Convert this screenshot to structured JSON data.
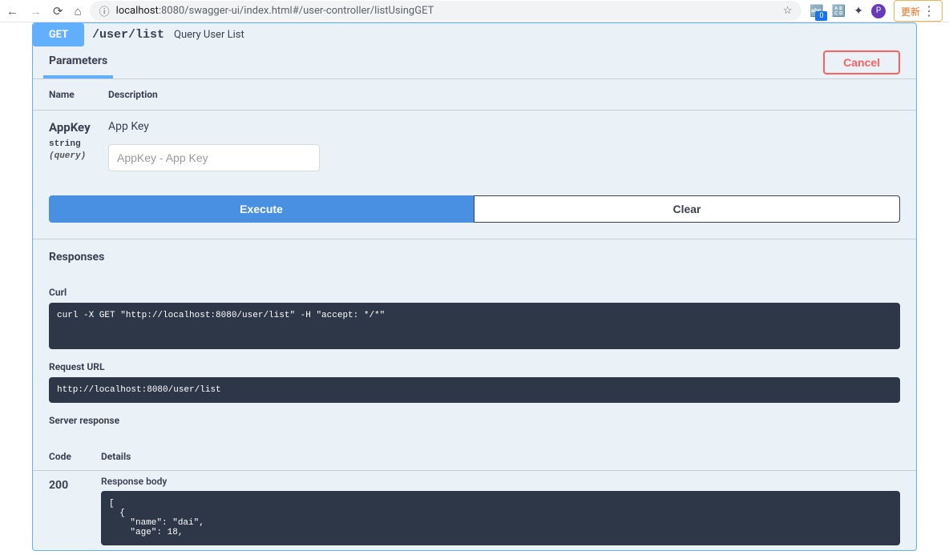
{
  "browser": {
    "url_domain": "localhost",
    "url_path": ":8080/swagger-ui/index.html#/user-controller/listUsingGET",
    "update_label": "更新",
    "avatar_letter": "P"
  },
  "operation": {
    "method": "GET",
    "path": "/user/list",
    "description": "Query User List"
  },
  "tabs": {
    "parameters": "Parameters",
    "cancel": "Cancel"
  },
  "param_headers": {
    "name": "Name",
    "description": "Description"
  },
  "parameters": {
    "name": "AppKey",
    "type": "string",
    "in": "(query)",
    "description": "App Key",
    "input_placeholder": "AppKey - App Key"
  },
  "actions": {
    "execute": "Execute",
    "clear": "Clear"
  },
  "responses": {
    "title": "Responses",
    "curl_label": "Curl",
    "curl_value": "curl -X GET \"http://localhost:8080/user/list\" -H \"accept: */*\"",
    "request_url_label": "Request URL",
    "request_url_value": "http://localhost:8080/user/list",
    "server_label": "Server response",
    "code_header": "Code",
    "details_header": "Details",
    "code_value": "200",
    "body_label": "Response body",
    "body_value": "[\n  {\n    \"name\": \"dai\",\n    \"age\": 18,"
  }
}
